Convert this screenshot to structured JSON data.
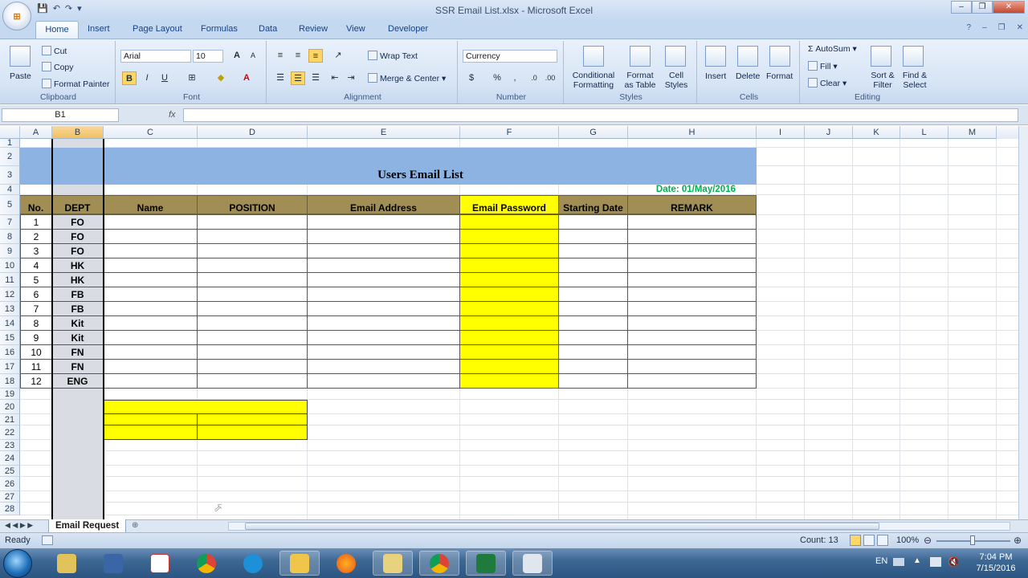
{
  "window": {
    "title": "SSR Email List.xlsx - Microsoft Excel"
  },
  "quick_access": {
    "save_icon": "save-icon",
    "undo_icon": "undo-icon",
    "redo_icon": "redo-icon"
  },
  "tabs": [
    "Home",
    "Insert",
    "Page Layout",
    "Formulas",
    "Data",
    "Review",
    "View",
    "Developer"
  ],
  "ribbon": {
    "clipboard": {
      "paste": "Paste",
      "cut": "Cut",
      "copy": "Copy",
      "format_painter": "Format Painter",
      "label": "Clipboard"
    },
    "font": {
      "font_name": "Arial",
      "font_size": "10",
      "bold": "B",
      "italic": "I",
      "underline": "U",
      "label": "Font"
    },
    "alignment": {
      "wrap_text": "Wrap Text",
      "merge_center": "Merge & Center",
      "label": "Alignment"
    },
    "number": {
      "format": "Currency",
      "dollar": "$",
      "percent": "%",
      "comma": ",",
      "label": "Number"
    },
    "styles": {
      "conditional": "Conditional",
      "conditional2": "Formatting",
      "format_as": "Format",
      "format_as2": "as Table",
      "cell": "Cell",
      "cell2": "Styles",
      "label": "Styles"
    },
    "cells": {
      "insert": "Insert",
      "delete": "Delete",
      "format": "Format",
      "label": "Cells"
    },
    "editing": {
      "autosum": "AutoSum",
      "fill": "Fill",
      "clear": "Clear",
      "sort": "Sort &",
      "sort2": "Filter",
      "find": "Find &",
      "find2": "Select",
      "label": "Editing"
    }
  },
  "formula_bar": {
    "name_box": "B1",
    "fx": "fx",
    "content": ""
  },
  "columns": [
    "A",
    "B",
    "C",
    "D",
    "E",
    "F",
    "G",
    "H",
    "I",
    "J",
    "K",
    "L",
    "M"
  ],
  "rows": [
    "1",
    "2",
    "3",
    "4",
    "5",
    "7",
    "8",
    "9",
    "10",
    "11",
    "12",
    "13",
    "14",
    "15",
    "16",
    "17",
    "18",
    "19",
    "20",
    "21",
    "22",
    "23",
    "24",
    "25",
    "26",
    "27",
    "28"
  ],
  "sheet": {
    "title": "Users Email List",
    "date": "Date: 01/May/2016",
    "headers": [
      "No.",
      "DEPT",
      "Name",
      "POSITION",
      "Email Address",
      "Email Password",
      "Starting Date",
      "REMARK"
    ],
    "records": [
      {
        "no": "1",
        "dept": "FO"
      },
      {
        "no": "2",
        "dept": "FO"
      },
      {
        "no": "3",
        "dept": "FO"
      },
      {
        "no": "4",
        "dept": "HK"
      },
      {
        "no": "5",
        "dept": "HK"
      },
      {
        "no": "6",
        "dept": "FB"
      },
      {
        "no": "7",
        "dept": "FB"
      },
      {
        "no": "8",
        "dept": "Kit"
      },
      {
        "no": "9",
        "dept": "Kit"
      },
      {
        "no": "10",
        "dept": "FN"
      },
      {
        "no": "11",
        "dept": "FN"
      },
      {
        "no": "12",
        "dept": "ENG"
      }
    ]
  },
  "sheet_tabs": {
    "active": "Email Request"
  },
  "status": {
    "ready": "Ready",
    "count": "Count: 13",
    "zoom": "100%"
  },
  "taskbar": {
    "lang": "EN",
    "time": "7:04 PM",
    "date": "7/15/2016"
  },
  "colors": {
    "header_fill": "#a08e55",
    "title_fill": "#8db3e2",
    "highlight": "#ffff00",
    "date_text": "#00b050"
  }
}
